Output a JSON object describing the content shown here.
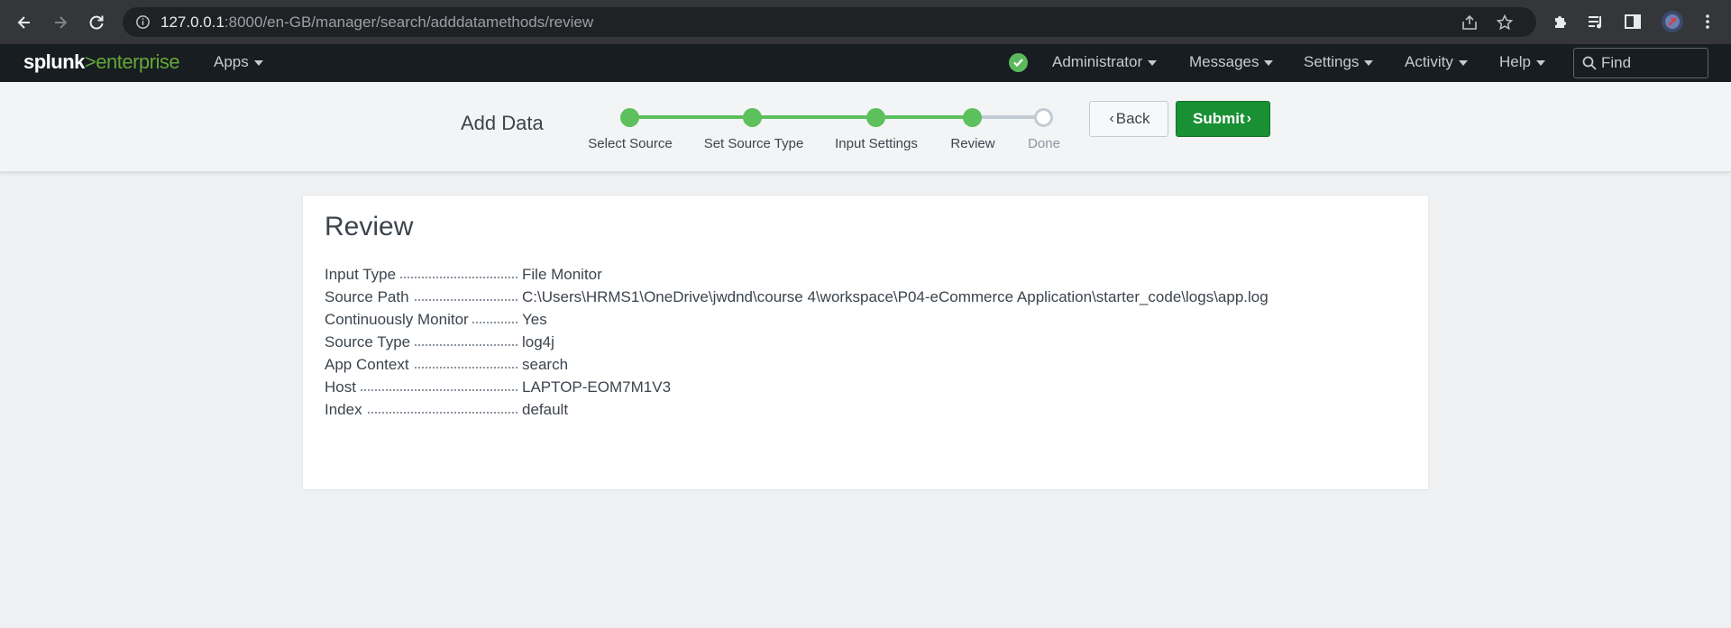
{
  "browser": {
    "url_host": "127.0.0.1",
    "url_rest": ":8000/en-GB/manager/search/adddatamethods/review"
  },
  "header": {
    "logo_brand": "splunk",
    "logo_gt": ">",
    "logo_product": "enterprise",
    "apps_label": "Apps",
    "status_color": "#5cb85c",
    "menu": {
      "administrator": "Administrator",
      "messages": "Messages",
      "settings": "Settings",
      "activity": "Activity",
      "help": "Help"
    },
    "find_placeholder": "Find"
  },
  "wizard": {
    "title": "Add Data",
    "steps": [
      {
        "label": "Select Source",
        "state": "complete"
      },
      {
        "label": "Set Source Type",
        "state": "complete"
      },
      {
        "label": "Input Settings",
        "state": "complete"
      },
      {
        "label": "Review",
        "state": "current"
      },
      {
        "label": "Done",
        "state": "pending"
      }
    ],
    "back_label": "Back",
    "submit_label": "Submit",
    "accent_color": "#5cc05c",
    "submit_color": "#1a9035"
  },
  "review": {
    "title": "Review",
    "rows": [
      {
        "key": "Input Type",
        "value": "File Monitor"
      },
      {
        "key": "Source Path",
        "value": "C:\\Users\\HRMS1\\OneDrive\\jwdnd\\course 4\\workspace\\P04-eCommerce Application\\starter_code\\logs\\app.log"
      },
      {
        "key": "Continuously Monitor",
        "value": "Yes"
      },
      {
        "key": "Source Type",
        "value": "log4j"
      },
      {
        "key": "App Context",
        "value": "search"
      },
      {
        "key": "Host",
        "value": "LAPTOP-EOM7M1V3"
      },
      {
        "key": "Index",
        "value": "default"
      }
    ]
  }
}
